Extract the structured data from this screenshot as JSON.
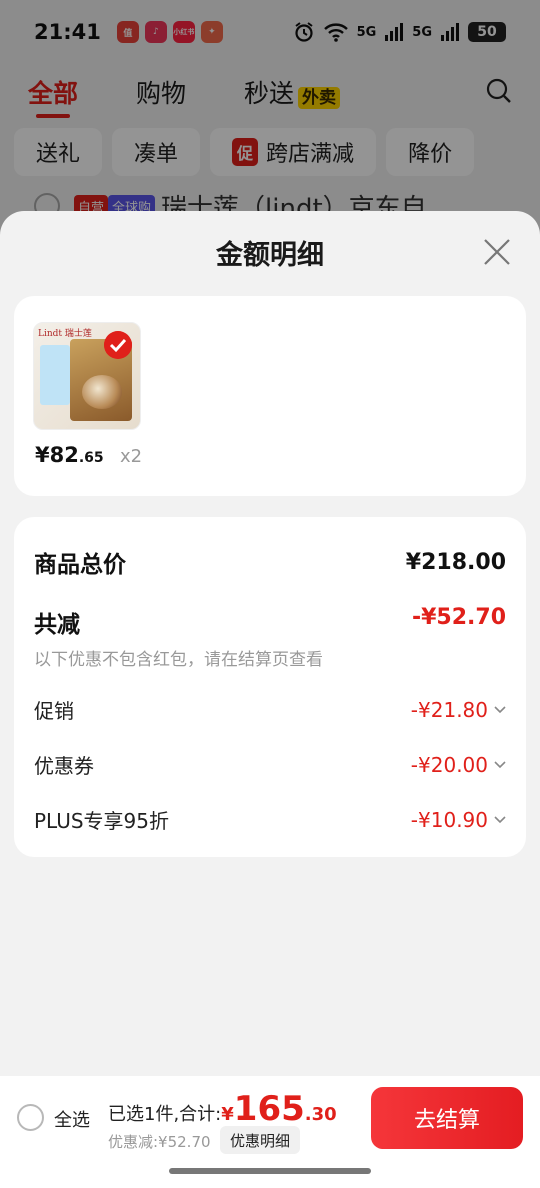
{
  "status_bar": {
    "time": "21:41",
    "signal_1": "5G",
    "signal_2": "5G",
    "battery": "50",
    "app_icons": [
      {
        "name": "值",
        "color": "#e8433a"
      },
      {
        "name": "♪",
        "color": "#f0365a"
      },
      {
        "name": "小红书",
        "color": "#ff2442"
      },
      {
        "name": "",
        "color": "#f26a4a"
      }
    ]
  },
  "background": {
    "tabs": [
      {
        "label": "全部"
      },
      {
        "label": "购物"
      },
      {
        "label": "秒送"
      }
    ],
    "waimai_tag": "外卖",
    "chips": [
      {
        "label": "送礼"
      },
      {
        "label": "凑单"
      },
      {
        "label": "跨店满减",
        "tag": "促"
      },
      {
        "label": "降价"
      }
    ],
    "item_tags": [
      "自营",
      "全球购"
    ],
    "item_title": "瑞士莲（lindt）京东自"
  },
  "sheet": {
    "title": "金额明细",
    "product": {
      "brand": "Lindt 瑞士莲",
      "price_int": "¥82",
      "price_dec": ".65",
      "qty": "x2"
    },
    "detail": {
      "total_label": "商品总价",
      "total_value": "¥218.00",
      "reduce_label": "共减",
      "reduce_value": "-¥52.70",
      "note": "以下优惠不包含红包，请在结算页查看",
      "items": [
        {
          "label": "促销",
          "value": "-¥21.80"
        },
        {
          "label": "优惠券",
          "value": "-¥20.00"
        },
        {
          "label": "PLUS专享95折",
          "value": "-¥10.90"
        }
      ]
    }
  },
  "bottom_bar": {
    "select_all": "全选",
    "selected_text": "已选1件,合计:",
    "total_yen": "¥",
    "total_int": "165",
    "total_dec": ".30",
    "discount_text": "优惠减:¥52.70",
    "detail_button": "优惠明细",
    "checkout_button": "去结算"
  },
  "colors": {
    "accent_red": "#e0201a",
    "plus_tag": "#5a55e8"
  }
}
